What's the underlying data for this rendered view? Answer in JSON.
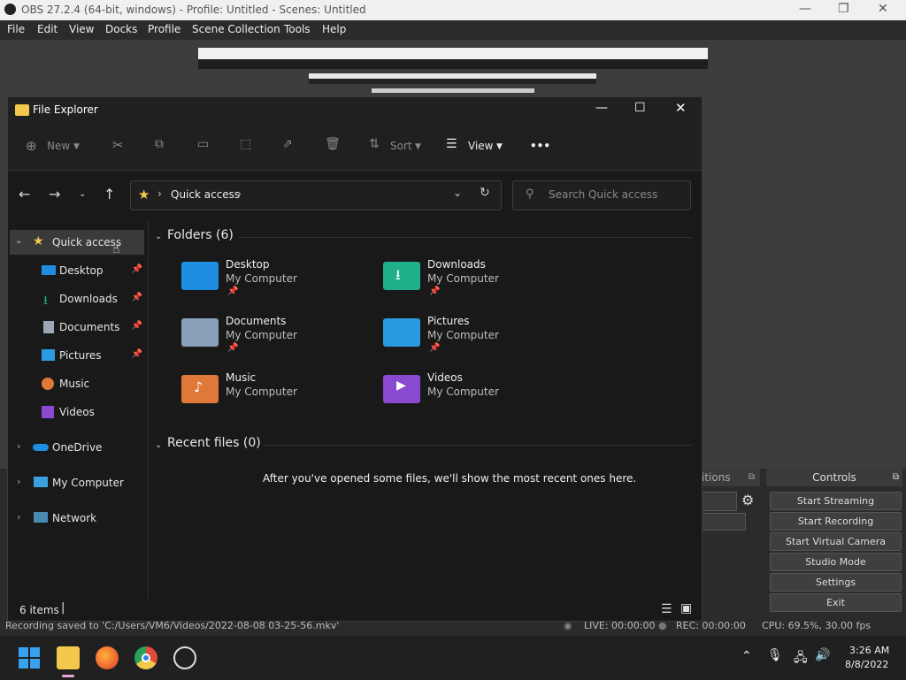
{
  "obs": {
    "title": "OBS 27.2.4 (64-bit, windows) - Profile: Untitled - Scenes: Untitled",
    "menu": [
      "File",
      "Edit",
      "View",
      "Docks",
      "Profile",
      "Scene Collection",
      "Tools",
      "Help"
    ],
    "controls_title": "Controls",
    "transitions_partial": "itions",
    "controls": [
      "Start Streaming",
      "Start Recording",
      "Start Virtual Camera",
      "Studio Mode",
      "Settings",
      "Exit"
    ],
    "status_message": "Recording saved to 'C:/Users/VM6/Videos/2022-08-08 03-25-56.mkv'",
    "live": "LIVE: 00:00:00",
    "rec": "REC: 00:00:00",
    "cpu": "CPU: 69.5%, 30.00 fps"
  },
  "explorer": {
    "title": "File Explorer",
    "toolbar": {
      "new": "New",
      "sort": "Sort",
      "view": "View",
      "more": "•••"
    },
    "address": "Quick access",
    "search_placeholder": "Search Quick access",
    "nav": {
      "quick_access": "Quick access",
      "items": [
        {
          "label": "Desktop",
          "pinned": true
        },
        {
          "label": "Downloads",
          "pinned": true
        },
        {
          "label": "Documents",
          "pinned": true
        },
        {
          "label": "Pictures",
          "pinned": true
        },
        {
          "label": "Music",
          "pinned": false
        },
        {
          "label": "Videos",
          "pinned": false
        }
      ],
      "onedrive": "OneDrive",
      "my_computer": "My Computer",
      "network": "Network"
    },
    "folders_header": "Folders (6)",
    "folders": [
      {
        "name": "Desktop",
        "location": "My Computer",
        "color": "#1e8fe0"
      },
      {
        "name": "Downloads",
        "location": "My Computer",
        "color": "#1fb08a"
      },
      {
        "name": "Documents",
        "location": "My Computer",
        "color": "#8aa0b8"
      },
      {
        "name": "Pictures",
        "location": "My Computer",
        "color": "#2a9be0"
      },
      {
        "name": "Music",
        "location": "My Computer",
        "color": "#e0783a"
      },
      {
        "name": "Videos",
        "location": "My Computer",
        "color": "#8a4ad0"
      }
    ],
    "recent_header": "Recent files (0)",
    "recent_empty": "After you've opened some files, we'll show the most recent ones here.",
    "status": "6 items"
  },
  "taskbar": {
    "time": "3:26 AM",
    "date": "8/8/2022"
  }
}
